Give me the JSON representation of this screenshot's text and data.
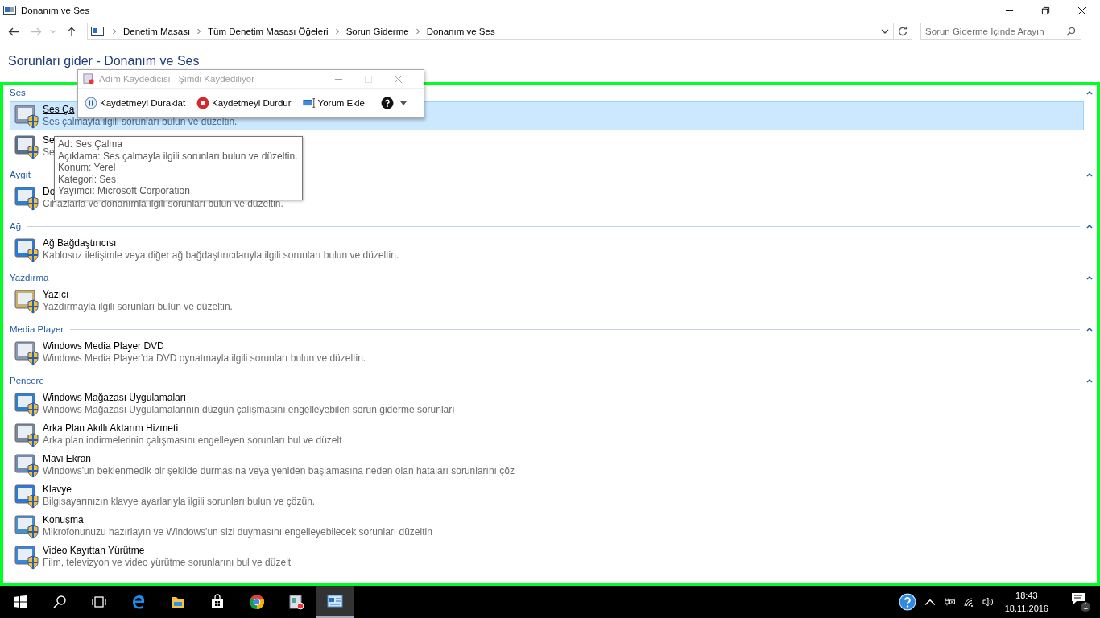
{
  "window": {
    "title": "Donanım ve Ses"
  },
  "address": {
    "breadcrumbs": [
      "Denetim Masası",
      "Tüm Denetim Masası Öğeleri",
      "Sorun Giderme",
      "Donanım ve Ses"
    ],
    "search": {
      "placeholder": "Sorun Giderme İçinde Arayın"
    }
  },
  "heading": "Sorunları gider - Donanım ve Ses",
  "sections": [
    {
      "title": "Ses",
      "items": [
        {
          "title": "Ses Ça",
          "description": "Ses çalmayla ilgili sorunları bulun ve düzeltin.",
          "selected": true
        },
        {
          "title": "Se",
          "description": "Se",
          "selected": false
        }
      ]
    },
    {
      "title": "Aygıt",
      "items": [
        {
          "title": "Do",
          "description": "Cihazlarla ve donanımla ilgili sorunları bulun ve düzeltin.",
          "selected": false
        }
      ]
    },
    {
      "title": "Ağ",
      "items": [
        {
          "title": "Ağ Bağdaştırıcısı",
          "description": "Kablosuz iletişimle veya diğer ağ bağdaştırıcılarıyla ilgili sorunları bulun ve düzeltin.",
          "selected": false
        }
      ]
    },
    {
      "title": "Yazdırma",
      "items": [
        {
          "title": "Yazıcı",
          "description": "Yazdırmayla ilgili sorunları bulun ve düzeltin.",
          "selected": false
        }
      ]
    },
    {
      "title": "Media Player",
      "items": [
        {
          "title": "Windows Media Player DVD",
          "description": "Windows Media Player'da DVD oynatmayla ilgili sorunları bulun ve düzeltin.",
          "selected": false
        }
      ]
    },
    {
      "title": "Pencere",
      "items": [
        {
          "title": "Windows Mağazası Uygulamaları",
          "description": "Windows Mağazası Uygulamalarının düzgün çalışmasını engelleyebilen sorun giderme sorunları",
          "selected": false
        },
        {
          "title": "Arka Plan Akıllı Aktarım Hizmeti",
          "description": "Arka plan indirmelerinin çalışmasını engelleyen sorunları bul ve düzelt",
          "selected": false
        },
        {
          "title": "Mavi Ekran",
          "description": "Windows'un beklenmedik bir şekilde durmasına veya yeniden başlamasına neden olan hataları sorunlarını çöz",
          "selected": false
        },
        {
          "title": "Klavye",
          "description": "Bilgisayarınızın klavye ayarlarıyla ilgili sorunları bulun ve çözün.",
          "selected": false
        },
        {
          "title": "Konuşma",
          "description": "Mikrofonunuzu hazırlayın ve Windows'un sizi duymasını engelleyebilecek sorunları düzeltin",
          "selected": false
        },
        {
          "title": "Video Kayıttan Yürütme",
          "description": "Film, televizyon ve video yürütme sorunlarını bul ve düzelt",
          "selected": false
        }
      ]
    }
  ],
  "recorder": {
    "title": "Adım Kaydedicisi - Şimdi Kaydediliyor",
    "buttons": [
      {
        "kind": "pause",
        "label": "Kaydetmeyi Duraklat"
      },
      {
        "kind": "stop",
        "label": "Kaydetmeyi Durdur"
      },
      {
        "kind": "comment",
        "label": "Yorum Ekle"
      }
    ]
  },
  "tooltip": [
    "Ad: Ses Çalma",
    "Açıklama: Ses çalmayla ilgili sorunları bulun ve düzeltin.",
    "Konum: Yerel",
    "Kategori: Ses",
    "Yayımcı: Microsoft Corporation"
  ],
  "taskbar": {
    "time": "18:43",
    "date": "18.11.2016",
    "notifications": "1"
  }
}
